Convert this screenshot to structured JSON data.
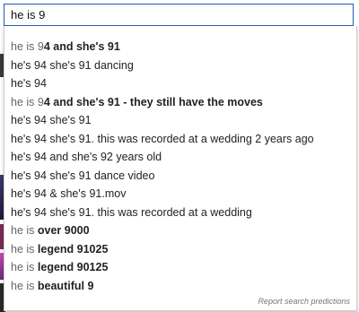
{
  "search": {
    "value": "he is 9"
  },
  "suggestions": [
    {
      "prefix": "he is 9",
      "rest": "4 and she's 91"
    },
    {
      "prefix": "",
      "rest": "he's 94 she's 91 dancing"
    },
    {
      "prefix": "",
      "rest": "he's 94"
    },
    {
      "prefix": "he is 9",
      "rest": "4 and she's 91 - they still have the moves"
    },
    {
      "prefix": "",
      "rest": "he's 94 she's 91"
    },
    {
      "prefix": "",
      "rest": "he's 94 she's 91. this was recorded at a wedding 2 years ago"
    },
    {
      "prefix": "",
      "rest": "he's 94 and she's 92 years old"
    },
    {
      "prefix": "",
      "rest": "he's 94 she's 91 dance video"
    },
    {
      "prefix": "",
      "rest": "he's 94 & she's 91.mov"
    },
    {
      "prefix": "",
      "rest": "he's 94 she's 91. this was recorded at a wedding"
    },
    {
      "prefix": "he is ",
      "rest": "over 9000"
    },
    {
      "prefix": "he is ",
      "rest": "legend 91025"
    },
    {
      "prefix": "he is ",
      "rest": "legend 90125"
    },
    {
      "prefix": "he is ",
      "rest": "beautiful 9"
    }
  ],
  "footer": {
    "report_label": "Report search predictions"
  }
}
